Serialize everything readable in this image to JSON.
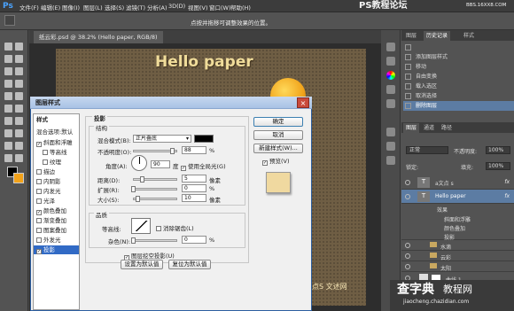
{
  "app": {
    "logo": "Ps"
  },
  "menubar": {
    "items": [
      "文件(F)",
      "编辑(E)",
      "图像(I)",
      "图层(L)",
      "选择(S)",
      "滤镜(T)",
      "分析(A)",
      "3D(D)",
      "视图(V)",
      "窗口(W)",
      "帮助(H)"
    ]
  },
  "watermark_top": {
    "title": "PS教程论坛",
    "url": "BBS.16XX8.COM"
  },
  "options_bar": {
    "hint": "点按并拖移可调整效果的位置。"
  },
  "document": {
    "tab": "纸云彩.psd @ 38.2% (Hello paper, RGB/8)",
    "headline": "Hello paper",
    "logo_text": "点S 文述网"
  },
  "history_panel": {
    "tabs": [
      "图层",
      "历史记录",
      "样式"
    ],
    "items": [
      "",
      "添加图层样式",
      "移动",
      "自由变换",
      "载入选区",
      "取消选择",
      "删除图层"
    ]
  },
  "layers_panel": {
    "tabs": [
      "图层",
      "通道",
      "路径"
    ],
    "blend": "正常",
    "opacity_label": "不透明度:",
    "opacity": "100%",
    "lock_label": "锁定:",
    "fill_label": "填充:",
    "fill": "100%",
    "layers": [
      {
        "name": "a文点 s",
        "fx": "fx"
      },
      {
        "name": "Hello paper",
        "fx": "fx"
      },
      {
        "name": "效果"
      },
      {
        "name": "斜面和浮雕"
      },
      {
        "name": "颜色叠加"
      },
      {
        "name": "投影"
      },
      {
        "name": "水滴"
      },
      {
        "name": "云彩"
      },
      {
        "name": "太阳"
      },
      {
        "name": "曲线 1"
      }
    ]
  },
  "watermark_bottom": {
    "brand": "查字典",
    "sub": "教程网",
    "url": "jiaocheng.chazidian.com"
  },
  "dialog": {
    "title": "图层样式",
    "close": "×",
    "styles": [
      {
        "label": "样式",
        "checked": null
      },
      {
        "label": "混合选项:默认",
        "checked": null
      },
      {
        "label": "斜面和浮雕",
        "checked": "✓"
      },
      {
        "label": "等高线",
        "checked": ""
      },
      {
        "label": "纹理",
        "checked": ""
      },
      {
        "label": "描边",
        "checked": ""
      },
      {
        "label": "内阴影",
        "checked": ""
      },
      {
        "label": "内发光",
        "checked": ""
      },
      {
        "label": "光泽",
        "checked": ""
      },
      {
        "label": "颜色叠加",
        "checked": "✓"
      },
      {
        "label": "渐变叠加",
        "checked": ""
      },
      {
        "label": "图案叠加",
        "checked": ""
      },
      {
        "label": "外发光",
        "checked": ""
      },
      {
        "label": "投影",
        "checked": "✓"
      }
    ],
    "section": "投影",
    "structure": {
      "title": "结构",
      "blend_mode_label": "混合模式(B):",
      "blend_mode": "正片叠底",
      "opacity_label": "不透明度(O):",
      "opacity": "88",
      "angle_label": "角度(A):",
      "angle": "90",
      "degree": "度",
      "global_light_label": "使用全局光(G)",
      "global_light_checked": "✓",
      "distance_label": "距离(D):",
      "distance": "5",
      "spread_label": "扩展(R):",
      "spread": "0",
      "size_label": "大小(S):",
      "size": "10",
      "px": "像素",
      "pct": "%",
      "opacity_frac": 0.88,
      "distance_frac": 0.2,
      "spread_frac": 0.0,
      "size_frac": 0.1,
      "shadow_color": "#000000"
    },
    "quality": {
      "title": "品质",
      "contour_label": "等高线:",
      "antialias_label": "消除锯齿(L)",
      "noise_label": "杂色(N):",
      "noise": "0",
      "pct": "%"
    },
    "knockout_label": "图层挖空投影(U)",
    "knockout_checked": "✓",
    "make_default": "设置为默认值",
    "reset_default": "复位为默认值",
    "buttons": {
      "ok": "确定",
      "cancel": "取消",
      "new_style": "新建样式(W)...",
      "preview_label": "预览(V)",
      "preview_checked": "✓"
    },
    "preview_swatch": "#f0d9a0"
  }
}
